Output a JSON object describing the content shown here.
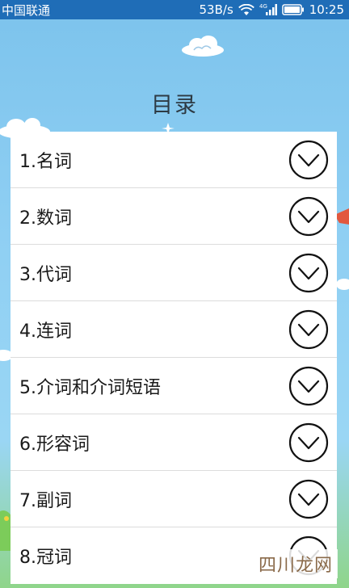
{
  "status_bar": {
    "carrier": "中国联通",
    "network_speed": "53B/s",
    "signal_type": "4G",
    "time": "10:25"
  },
  "header": {
    "title": "目录"
  },
  "toc": {
    "items": [
      {
        "label": "1.名词"
      },
      {
        "label": "2.数词"
      },
      {
        "label": "3.代词"
      },
      {
        "label": "4.连词"
      },
      {
        "label": "5.介词和介词短语"
      },
      {
        "label": "6.形容词"
      },
      {
        "label": "7.副词"
      },
      {
        "label": "8.冠词"
      }
    ]
  },
  "watermark": {
    "text": "四川龙网"
  },
  "colors": {
    "status_bar_bg": "#1f6db7",
    "sky": "#8fcff3",
    "panel": "#ffffff"
  }
}
